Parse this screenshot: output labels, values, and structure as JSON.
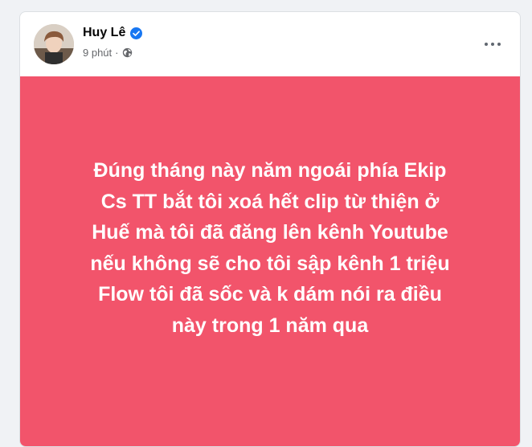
{
  "post": {
    "author": "Huy Lê",
    "time": "9 phút",
    "separator": "·",
    "verified_icon": "verified-badge-icon",
    "privacy_icon": "globe-icon",
    "more_icon": "more-options-icon",
    "lines": [
      "Đúng tháng này năm ngoái phía Ekip",
      "Cs TT bắt tôi xoá hết clip từ thiện ở",
      "Huế mà tôi đã đăng lên kênh Youtube",
      "nếu không sẽ cho tôi sập kênh 1 triệu",
      "Flow tôi đã sốc và k dám nói ra điều",
      "này trong 1 năm qua"
    ],
    "background_color": "#f2546b",
    "text_color": "#ffffff",
    "verified_color": "#1877f2"
  }
}
